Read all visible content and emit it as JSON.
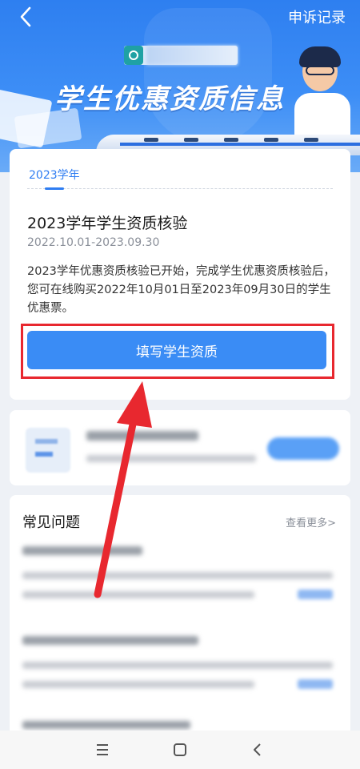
{
  "header": {
    "appeal_link": "申诉记录",
    "title": "学生优惠资质信息"
  },
  "main_card": {
    "year_tab": "2023学年",
    "check_title": "2023学年学生资质核验",
    "check_period": "2022.10.01-2023.09.30",
    "check_desc": "2023学年优惠资质核验已开始，完成学生优惠资质核验后，您可在线购买2022年10月01日至2023年09月30日的学生优惠票。",
    "cta_label": "填写学生资质"
  },
  "faq": {
    "title": "常见问题",
    "more_label": "查看更多>"
  },
  "colors": {
    "accent": "#3a8cf5",
    "highlight": "#e8282f"
  },
  "navbar": {
    "icons": [
      "menu-icon",
      "home-square-icon",
      "back-triangle-icon"
    ]
  }
}
